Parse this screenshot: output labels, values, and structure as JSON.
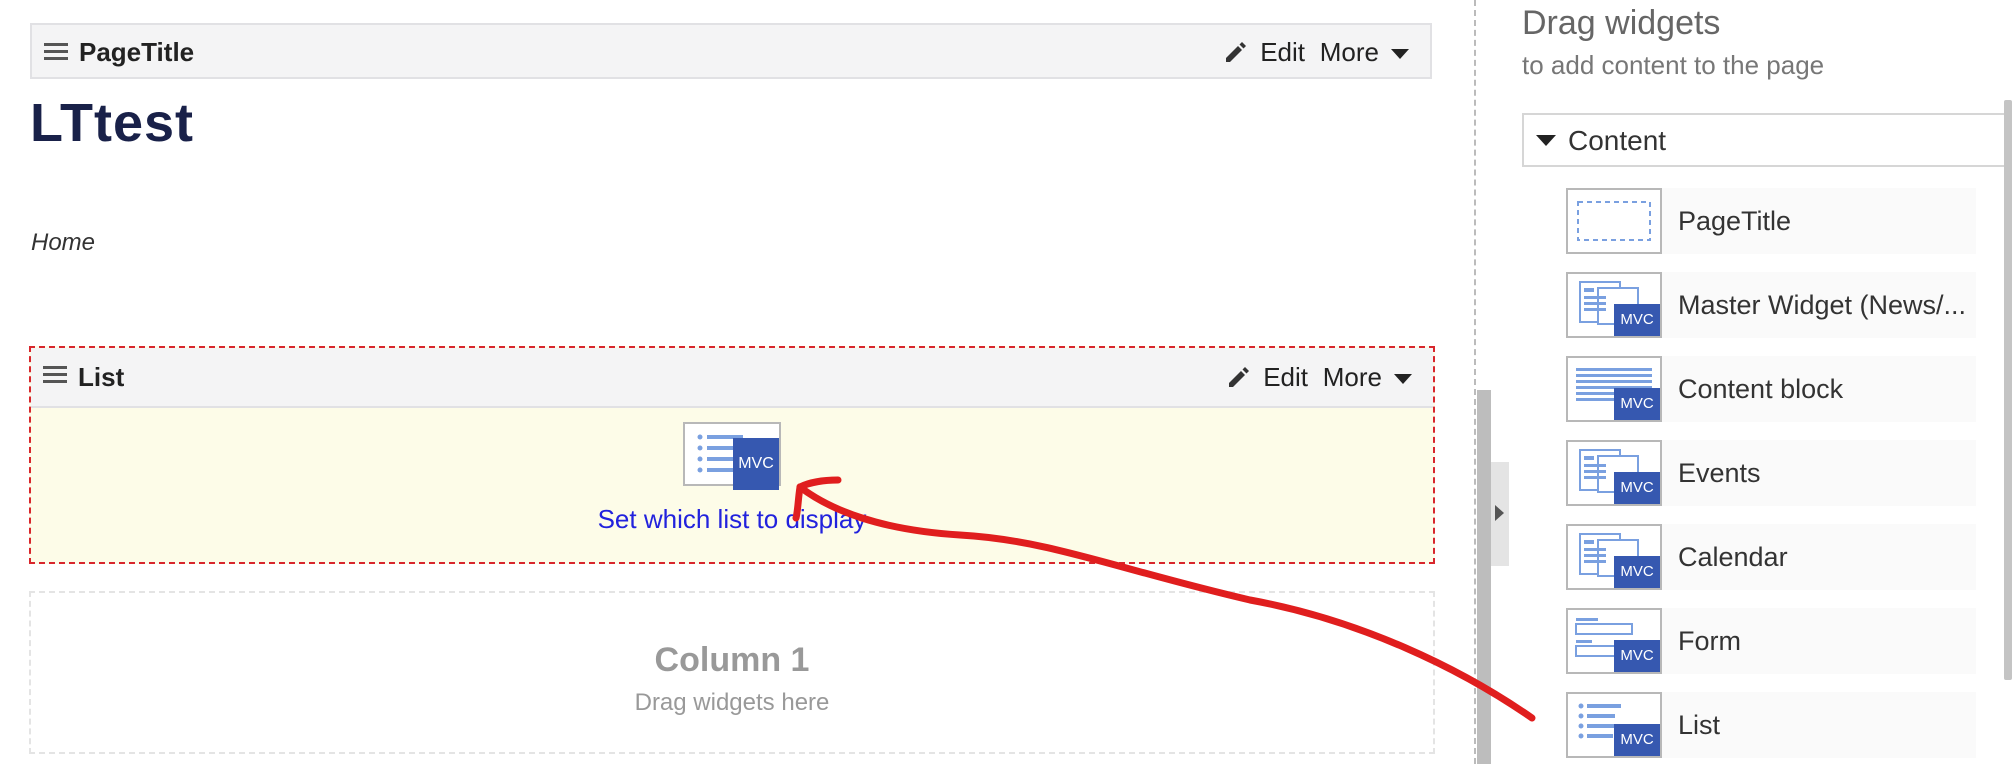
{
  "editor": {
    "page_title_widget": {
      "label": "PageTitle",
      "edit": "Edit",
      "more": "More"
    },
    "page_heading": "LTtest",
    "breadcrumb": "Home",
    "list_widget": {
      "label": "List",
      "edit": "Edit",
      "more": "More",
      "icon_badge": "MVC",
      "link": "Set which list to display"
    },
    "column": {
      "title": "Column 1",
      "hint": "Drag widgets here"
    }
  },
  "panel": {
    "title": "Drag widgets",
    "subtitle": "to add content to the page",
    "section": "Content",
    "items": [
      {
        "name": "PageTitle",
        "icon": "page-title-icon",
        "badge": ""
      },
      {
        "name": "Master Widget (News/...",
        "icon": "master-widget-icon",
        "badge": "MVC"
      },
      {
        "name": "Content block",
        "icon": "content-block-icon",
        "badge": "MVC"
      },
      {
        "name": "Events",
        "icon": "events-icon",
        "badge": "MVC"
      },
      {
        "name": "Calendar",
        "icon": "calendar-icon",
        "badge": "MVC"
      },
      {
        "name": "Form",
        "icon": "form-icon",
        "badge": "MVC"
      },
      {
        "name": "List",
        "icon": "list-icon",
        "badge": "MVC"
      }
    ]
  },
  "colors": {
    "heading": "#192149",
    "link": "#2222dd",
    "mvc_badge": "#3658b0",
    "drop_zone_border": "#d8262c",
    "drop_zone_fill": "#fdfce8",
    "annotation_arrow": "#e01e1e"
  }
}
